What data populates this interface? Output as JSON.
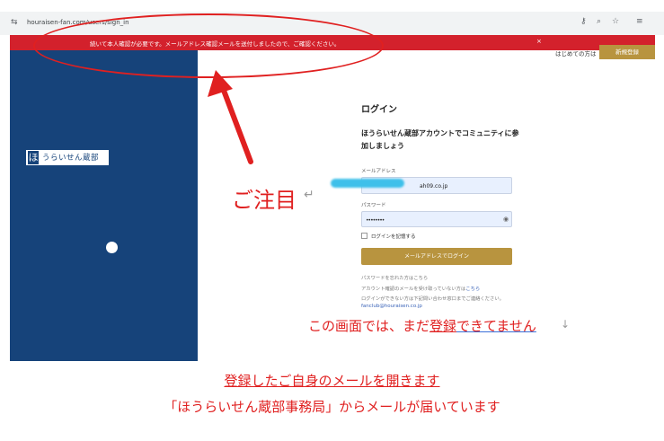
{
  "browser": {
    "url": "houraisen-fan.com/users/sign_in",
    "icons": [
      "tune-icon",
      "key-icon",
      "zoom-icon",
      "star-icon",
      "menu-icon"
    ]
  },
  "notice_banner": {
    "text": "続いて本人確認が必要です。メールアドレス確認メールを送付しましたので、ご確認ください。",
    "close": "×",
    "color": "#d3212c"
  },
  "header": {
    "first_time_text": "はじめての方は",
    "register_label": "新規登録"
  },
  "brand": {
    "logo_mark": "ほ",
    "logo_text": "うらいせん蔵部",
    "color": "#16437a"
  },
  "login": {
    "title": "ログイン",
    "lead": "ほうらいせん蔵部アカウントでコミュニティに参加しましょう",
    "email_label": "メールアドレス",
    "email_value": "ah09.co.jp",
    "password_label": "パスワード",
    "password_value": "••••••••",
    "remember_label": "ログインを記憶する",
    "login_button": "メールアドレスでログイン",
    "forgot_text": "パスワードを忘れた方はこちら",
    "resend_text": "アカウント確認のメールを受け取っていない方は",
    "resend_link": "こちら",
    "contact_text": "ログインができない方は下記問い合わせ窓口までご連絡ください。",
    "contact_email": "fanclub@houraisen.co.jp",
    "accent": "#b8943f"
  },
  "annotations": {
    "attention": "ご注目",
    "status_a": "この画面では、まだ",
    "status_b": "登録",
    "status_c": "できてません",
    "step1_a": "登録した",
    "step1_b": "ご自身のメールを開きます",
    "step2": "「ほうらいせん蔵部事務局」からメールが届いています",
    "return_mark": "↵",
    "down_mark": "↓",
    "color": "#e02020"
  }
}
